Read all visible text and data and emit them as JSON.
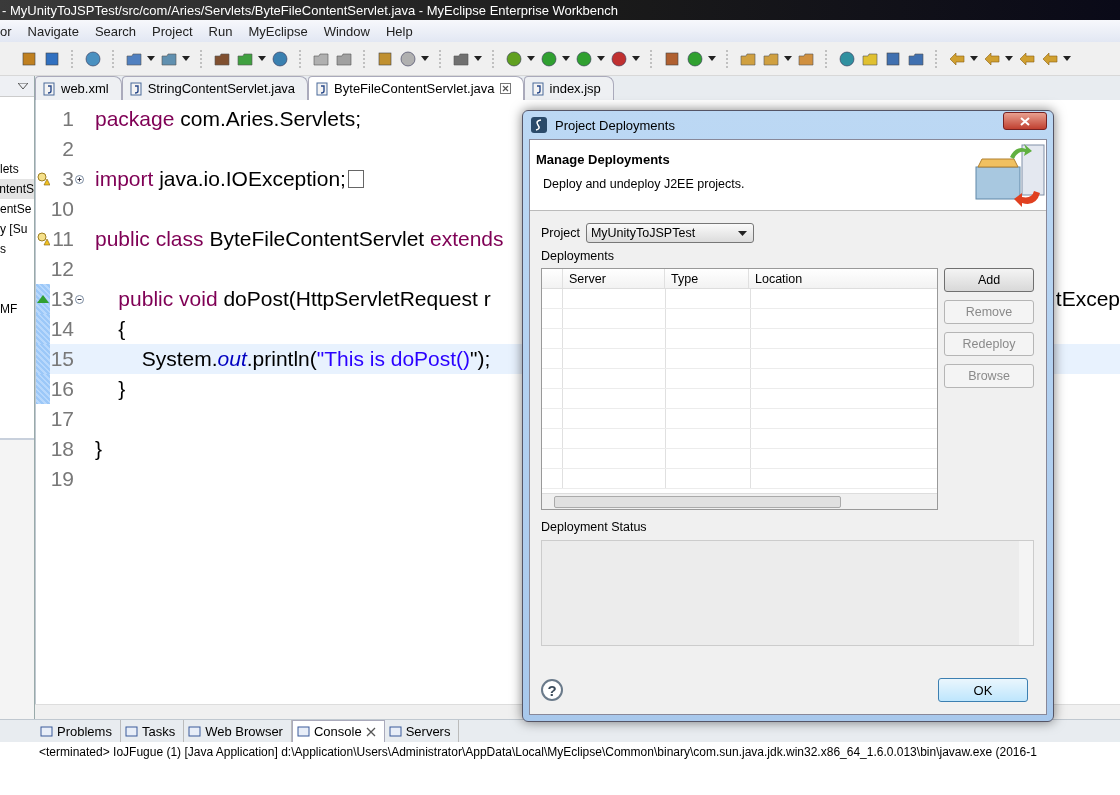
{
  "window": {
    "title": "- MyUnityToJSPTest/src/com/Aries/Servlets/ByteFileContentServlet.java - MyEclipse Enterprise Workbench"
  },
  "menu": [
    "or",
    "Navigate",
    "Search",
    "Project",
    "Run",
    "MyEclipse",
    "Window",
    "Help"
  ],
  "left_panel": {
    "items": [
      {
        "label": "lets",
        "selected": false
      },
      {
        "label": "ntentS",
        "selected": true
      },
      {
        "label": "entSe",
        "selected": false
      },
      {
        "label": "y [Su",
        "selected": false
      },
      {
        "label": "s",
        "selected": false
      },
      {
        "label": "MF",
        "selected": false
      }
    ]
  },
  "editor_tabs": [
    {
      "label": "web.xml",
      "selected": false
    },
    {
      "label": "StringContentServlet.java",
      "selected": false
    },
    {
      "label": "ByteFileContentServlet.java",
      "selected": true
    },
    {
      "label": "index.jsp",
      "selected": false
    }
  ],
  "code_lines": [
    {
      "number": "1",
      "warning": false,
      "override": false,
      "foldable": false,
      "collapsed": false,
      "changed": false,
      "current": false,
      "tokens": [
        {
          "kind": "kw",
          "text": "package"
        },
        {
          "kind": "plain",
          "text": " com.Aries.Servlets;"
        }
      ]
    },
    {
      "number": "2",
      "warning": false,
      "override": false,
      "foldable": false,
      "collapsed": false,
      "changed": false,
      "current": false
    },
    {
      "number": "3",
      "warning": true,
      "override": false,
      "foldable": true,
      "collapsed": true,
      "changed": false,
      "current": false,
      "tokens": [
        {
          "kind": "kw",
          "text": "import"
        },
        {
          "kind": "plain",
          "text": " java.io.IOException;"
        }
      ]
    },
    {
      "number": "10",
      "warning": false,
      "override": false,
      "foldable": false,
      "collapsed": false,
      "changed": false,
      "current": false
    },
    {
      "number": "11",
      "warning": true,
      "override": false,
      "foldable": false,
      "collapsed": false,
      "changed": false,
      "current": false,
      "tokens": [
        {
          "kind": "kw",
          "text": "public class"
        },
        {
          "kind": "plain",
          "text": " ByteFileContentServlet "
        },
        {
          "kind": "kw",
          "text": "extends"
        }
      ]
    },
    {
      "number": "12",
      "warning": false,
      "override": false,
      "foldable": false,
      "collapsed": false,
      "changed": false,
      "current": false
    },
    {
      "number": "13",
      "warning": false,
      "override": true,
      "foldable": true,
      "collapsed": false,
      "changed": true,
      "current": false,
      "tokens": [
        {
          "kind": "kw",
          "text": "    public void"
        },
        {
          "kind": "plain",
          "text": " doPost(HttpServletRequest r"
        }
      ],
      "tail": "tExcep"
    },
    {
      "number": "14",
      "warning": false,
      "override": false,
      "foldable": false,
      "collapsed": false,
      "changed": true,
      "current": false,
      "tokens": [
        {
          "kind": "plain",
          "text": "    {"
        }
      ]
    },
    {
      "number": "15",
      "warning": false,
      "override": false,
      "foldable": false,
      "collapsed": false,
      "changed": true,
      "current": true,
      "tokens": [
        {
          "kind": "plain",
          "text": "        System."
        },
        {
          "kind": "field",
          "text": "out"
        },
        {
          "kind": "plain",
          "text": ".println("
        },
        {
          "kind": "string",
          "text": "\"This is doPost()"
        },
        {
          "kind": "plain",
          "text": "\");"
        }
      ]
    },
    {
      "number": "16",
      "warning": false,
      "override": false,
      "foldable": false,
      "collapsed": false,
      "changed": true,
      "current": false,
      "tokens": [
        {
          "kind": "plain",
          "text": "    }"
        }
      ]
    },
    {
      "number": "17",
      "warning": false,
      "override": false,
      "foldable": false,
      "collapsed": false,
      "changed": false,
      "current": false
    },
    {
      "number": "18",
      "warning": false,
      "override": false,
      "foldable": false,
      "collapsed": false,
      "changed": false,
      "current": false,
      "tokens": [
        {
          "kind": "plain",
          "text": "}"
        }
      ]
    },
    {
      "number": "19",
      "warning": false,
      "override": false,
      "foldable": false,
      "collapsed": false,
      "changed": false,
      "current": false
    }
  ],
  "dialog": {
    "title": "Project Deployments",
    "heading": "Manage Deployments",
    "description": "Deploy and undeploy J2EE projects.",
    "project_label": "Project",
    "project_value": "MyUnityToJSPTest",
    "deployments_label": "Deployments",
    "columns": [
      "Server",
      "Type",
      "Location"
    ],
    "buttons": [
      {
        "label": "Add",
        "disabled": false
      },
      {
        "label": "Remove",
        "disabled": true
      },
      {
        "label": "Redeploy",
        "disabled": true
      },
      {
        "label": "Browse",
        "disabled": true
      }
    ],
    "status_label": "Deployment Status",
    "help": "?",
    "ok": "OK"
  },
  "bottom_tabs": [
    {
      "label": "Problems",
      "selected": false
    },
    {
      "label": "Tasks",
      "selected": false
    },
    {
      "label": "Web Browser",
      "selected": false
    },
    {
      "label": "Console",
      "selected": true
    },
    {
      "label": "Servers",
      "selected": false
    }
  ],
  "console_line": "<terminated> IoJFugue (1) [Java Application] d:\\Application\\Users\\Administrator\\AppData\\Local\\MyEclipse\\Common\\binary\\com.sun.java.jdk.win32.x86_64_1.6.0.013\\bin\\javaw.exe (2016-1"
}
